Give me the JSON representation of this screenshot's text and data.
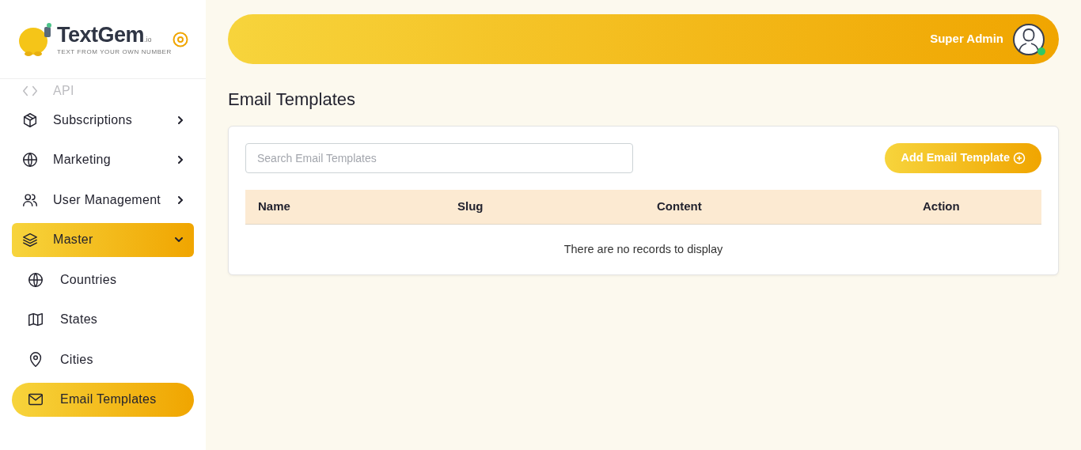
{
  "logo": {
    "name": "TextGem",
    "suffix": ".io",
    "tagline": "TEXT FROM YOUR OWN NUMBER"
  },
  "sidebar": {
    "items": [
      {
        "label": "API",
        "kind": "link",
        "selected": false
      },
      {
        "label": "Subscriptions",
        "kind": "group",
        "expanded": false,
        "selected": false
      },
      {
        "label": "Marketing",
        "kind": "group",
        "expanded": false,
        "selected": false
      },
      {
        "label": "User Management",
        "kind": "group",
        "expanded": false,
        "selected": false
      },
      {
        "label": "Master",
        "kind": "group",
        "expanded": true,
        "selected": true,
        "children": [
          {
            "label": "Countries",
            "selected": false
          },
          {
            "label": "States",
            "selected": false
          },
          {
            "label": "Cities",
            "selected": false
          },
          {
            "label": "Email Templates",
            "selected": true
          }
        ]
      }
    ]
  },
  "header": {
    "user": "Super Admin",
    "online": true
  },
  "page_title": "Email Templates",
  "search": {
    "placeholder": "Search Email Templates"
  },
  "add_button": "Add Email Template",
  "table": {
    "columns": [
      "Name",
      "Slug",
      "Content",
      "Action"
    ],
    "empty_message": "There are no records to display"
  }
}
